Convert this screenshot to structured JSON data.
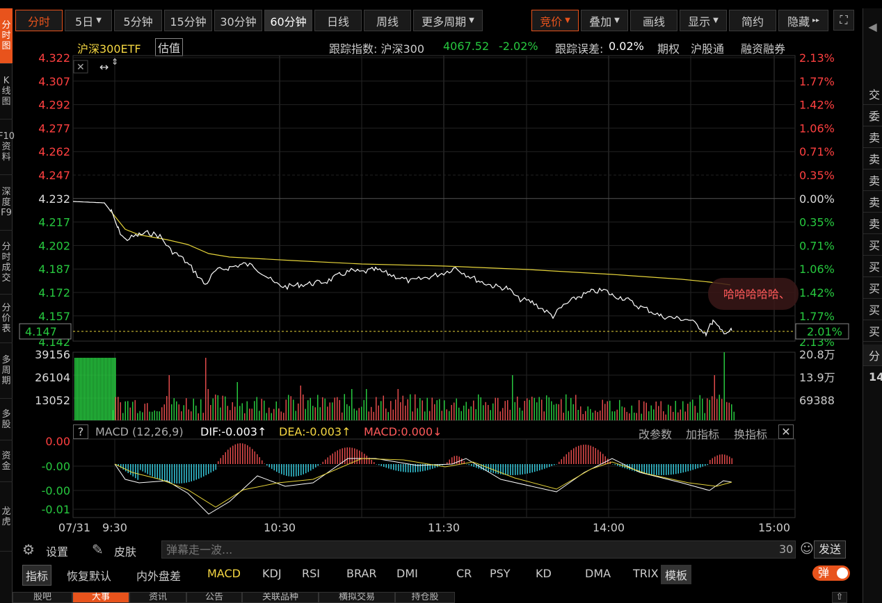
{
  "left_nav": [
    {
      "label": "分时图",
      "active": true
    },
    {
      "label": "K线图",
      "active": false
    },
    {
      "label": "F10资料",
      "active": false
    },
    {
      "label": "深度F9",
      "active": false
    },
    {
      "label": "分时成交",
      "active": false
    },
    {
      "label": "分价表",
      "active": false
    },
    {
      "label": "多周期",
      "active": false
    },
    {
      "label": "多股",
      "active": false
    },
    {
      "label": "资金",
      "active": false
    },
    {
      "label": "龙虎",
      "active": false
    }
  ],
  "topbar": {
    "periods": [
      {
        "label": "分时",
        "style": "active"
      },
      {
        "label": "5日",
        "dropdown": true
      },
      {
        "label": "5分钟"
      },
      {
        "label": "15分钟"
      },
      {
        "label": "30分钟"
      },
      {
        "label": "60分钟",
        "style": "sel"
      },
      {
        "label": "日线"
      },
      {
        "label": "周线"
      },
      {
        "label": "更多周期",
        "dropdown": true
      }
    ],
    "tools": [
      {
        "label": "竞价",
        "dropdown": true,
        "style": "active"
      },
      {
        "label": "叠加",
        "dropdown": true
      },
      {
        "label": "画线"
      },
      {
        "label": "显示",
        "dropdown": true
      },
      {
        "label": "简约"
      },
      {
        "label": "隐藏",
        "suffix": "▸▸"
      }
    ]
  },
  "info": {
    "name": "沪深300ETF",
    "valuation_btn": "估值",
    "tracking_index_label": "跟踪指数: 沪深300",
    "tracking_index_value": "4067.52",
    "tracking_index_change": "-2.02%",
    "tracking_error_label": "跟踪误差:",
    "tracking_error_value": "0.02%",
    "links": [
      "期权",
      "沪股通",
      "融资融券"
    ]
  },
  "price_axis": {
    "left": [
      "4.322",
      "4.307",
      "4.292",
      "4.277",
      "4.262",
      "4.247",
      "4.232",
      "4.217",
      "4.202",
      "4.187",
      "4.172",
      "4.157"
    ],
    "right": [
      "2.13%",
      "1.77%",
      "1.42%",
      "1.06%",
      "0.71%",
      "0.35%",
      "0.00%",
      "0.35%",
      "0.71%",
      "1.06%",
      "1.42%",
      "1.77%"
    ],
    "current_price": "4.147",
    "current_pct": "2.01%",
    "partial_left": "4.142",
    "partial_right": "2.13%"
  },
  "volume_axis": {
    "left": [
      "39156",
      "26104",
      "13052"
    ],
    "right": [
      "20.8万",
      "13.9万",
      "69388"
    ]
  },
  "macd": {
    "title": "MACD (12,26,9)",
    "dif": "DIF:-0.003↑",
    "dea": "DEA:-0.003↑",
    "macd": "MACD:0.000↓",
    "actions": [
      "改参数",
      "加指标",
      "换指标"
    ],
    "axis": [
      "0.00",
      "-0.00",
      "-0.00",
      "-0.01"
    ]
  },
  "time_axis": [
    "07/31",
    "9:30",
    "10:30",
    "11:30",
    "14:00",
    "15:00"
  ],
  "annotation": "哈哈哈哈哈、",
  "colors": {
    "up": "#ff4040",
    "down": "#27c93f",
    "price_line": "#ffffff",
    "avg_line": "#e6d43a",
    "accent": "#e8531c",
    "macd_cyan": "#35c6d8"
  },
  "danmu": {
    "settings": "设置",
    "skin": "皮肤",
    "placeholder": "弹幕走一波...",
    "count": "30",
    "send": "发送"
  },
  "indicator_bar": {
    "label": "指标",
    "items": [
      "恢复默认",
      "内外盘差",
      "MACD",
      "KDJ",
      "RSI",
      "BRAR",
      "DMI",
      "CR",
      "PSY",
      "KD",
      "DMA",
      "TRIX"
    ],
    "template": "模板",
    "toggle": "弹"
  },
  "bottom_tabs": [
    "股吧",
    "大事",
    "资讯",
    "公告",
    "关联品种",
    "横拟交易",
    "持仓股"
  ],
  "right_panel": [
    "交",
    "委",
    "卖",
    "卖",
    "卖",
    "卖",
    "卖",
    "买",
    "买",
    "买",
    "买",
    "买",
    "分",
    "14"
  ]
}
